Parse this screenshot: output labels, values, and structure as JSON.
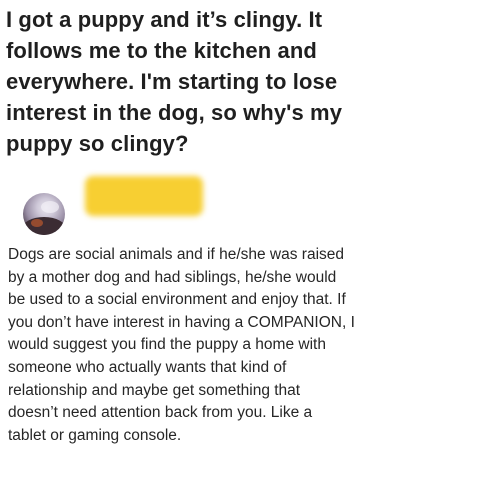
{
  "question": {
    "title": "I got a puppy and it’s clingy. It\nfollows me to the kitchen and\neverywhere. I'm starting to lose\ninterest in the dog, so why's my\npuppy so clingy?"
  },
  "answer": {
    "avatar_icon": "user-avatar-icon",
    "redaction_color": "#f7cf32",
    "body": "Dogs are social animals and if he/she was raised\nby a mother dog and had siblings, he/she would\nbe used to a social environment and enjoy that. If\nyou don’t have interest in having a COMPANION, I\nwould suggest you find the puppy a home with\nsomeone who actually wants that kind of\nrelationship and maybe get something that\ndoesn’t need attention back from you. Like a\ntablet or gaming console."
  }
}
